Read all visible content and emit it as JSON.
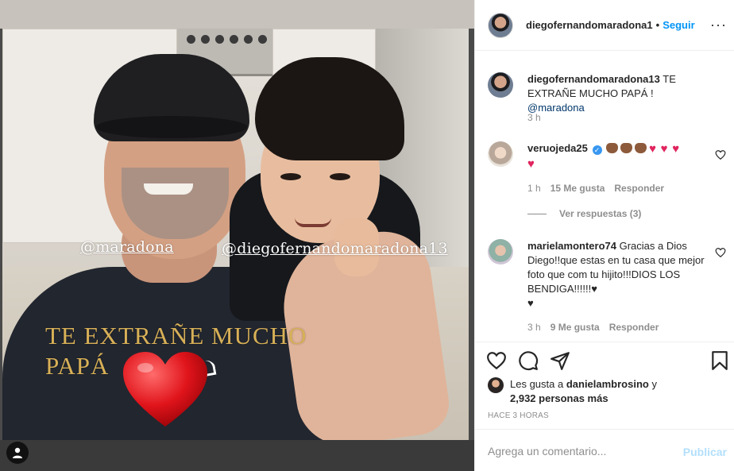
{
  "post": {
    "image_texts": {
      "tag_left": "@maradona",
      "tag_right": "@diegofernandomaradona13",
      "caption_line1": "TE EXTRAÑE MUCHO",
      "caption_line2": "PAPÁ"
    }
  },
  "header": {
    "username": "diegofernandomaradona1",
    "separator": "•",
    "follow_label": "Seguir",
    "more_label": "···"
  },
  "caption": {
    "username": "diegofernandomaradona13",
    "text": " TE EXTRAÑE MUCHO PAPÁ ! ",
    "mention": "@maradona",
    "time": "3 h"
  },
  "comments": [
    {
      "username": "veruojeda25",
      "time": "1 h",
      "likes": "15 Me gusta",
      "reply_label": "Responder",
      "view_replies": "Ver respuestas (3)"
    },
    {
      "username": "marielamontero74",
      "text": " Gracias a Dios Diego!!que estas en tu casa que mejor foto que com tu hijito!!!DIOS LOS BENDIGA!!!!!!",
      "time": "3 h",
      "likes": "9 Me gusta",
      "reply_label": "Responder"
    }
  ],
  "actions": {
    "likes_prefix": "Les gusta a ",
    "likes_user": "danielambrosino",
    "likes_conj": " y",
    "likes_count": "2,932 personas más",
    "time_ago": "HACE 3 HORAS"
  },
  "comment_box": {
    "placeholder": "Agrega un comentario...",
    "publish_label": "Publicar"
  },
  "colors": {
    "accent": "#0095f6",
    "publish_disabled": "#b2dffc",
    "heart": "#e0245e",
    "caption_gold": "#d8b057"
  },
  "icons": [
    "user-icon",
    "more-icon",
    "verified-icon",
    "heart-outline-icon",
    "comment-icon",
    "share-icon",
    "bookmark-icon"
  ]
}
